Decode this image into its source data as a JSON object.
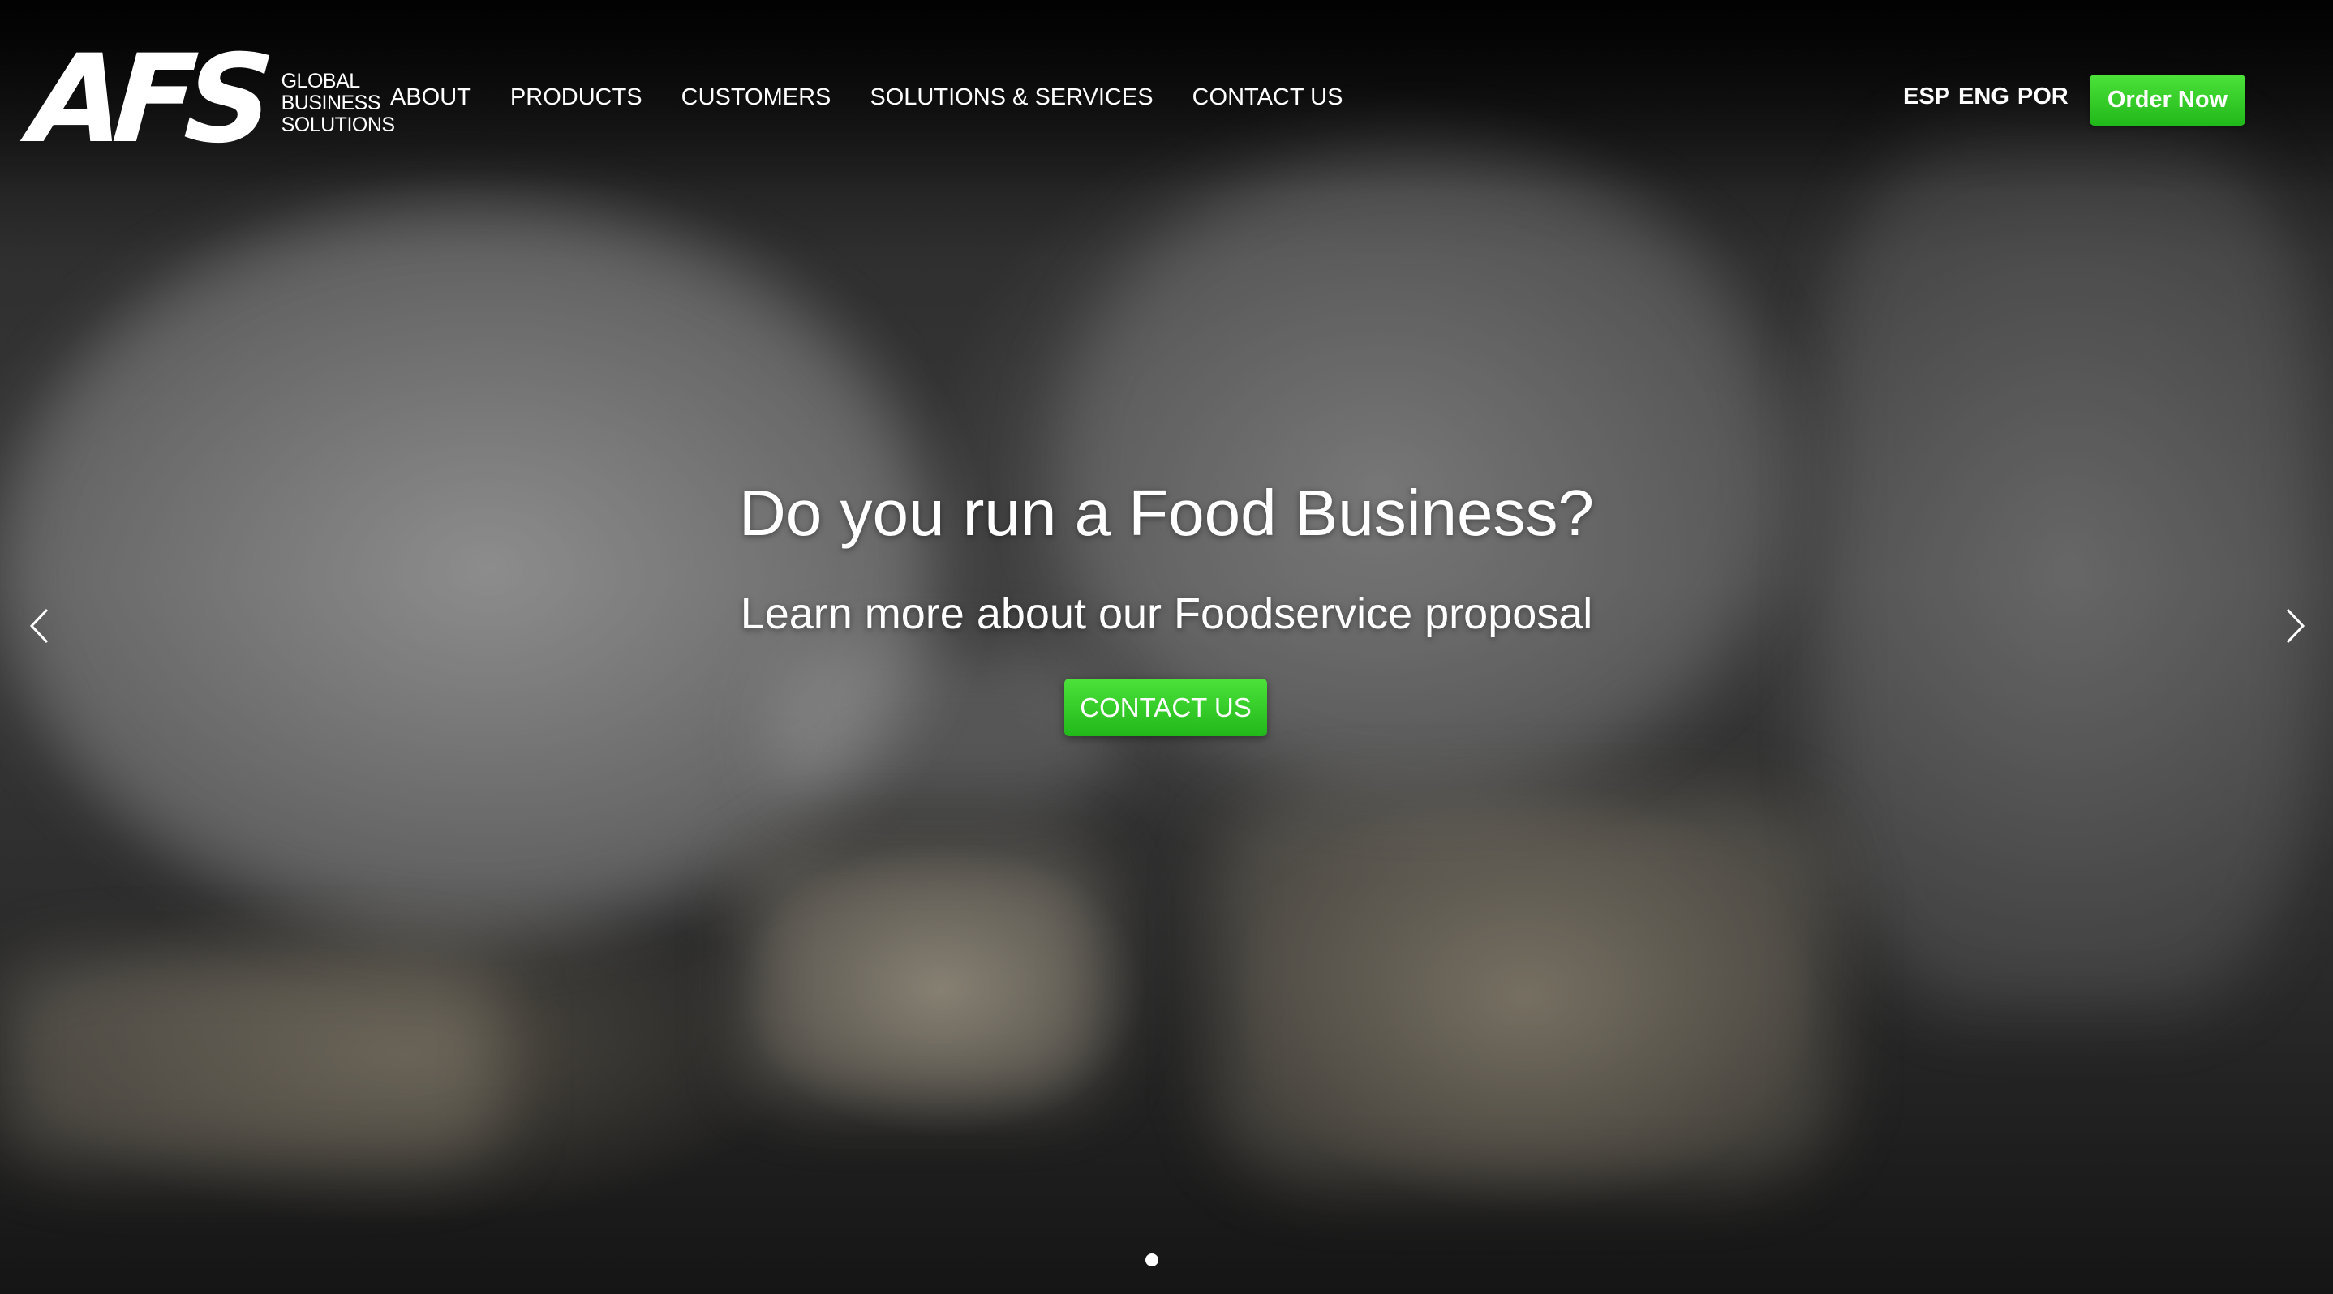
{
  "logo": {
    "mark": "AFS",
    "line1": "GLOBAL",
    "line2": "BUSINESS",
    "line3": "SOLUTIONS"
  },
  "nav": {
    "items": [
      {
        "label": "ABOUT"
      },
      {
        "label": "PRODUCTS"
      },
      {
        "label": "CUSTOMERS"
      },
      {
        "label": "SOLUTIONS & SERVICES"
      },
      {
        "label": "CONTACT US"
      }
    ]
  },
  "languages": [
    "ESP",
    "ENG",
    "POR"
  ],
  "order_button": "Order Now",
  "hero": {
    "headline": "Do you run a Food Business?",
    "subline": "Learn more about our Foodservice proposal",
    "cta": "CONTACT US"
  },
  "carousel": {
    "prev_icon": "chevron-left-icon",
    "next_icon": "chevron-right-icon",
    "slide_count": 1,
    "active_slide": 1
  },
  "colors": {
    "accent_green": "#33c92a",
    "text": "#ffffff"
  }
}
